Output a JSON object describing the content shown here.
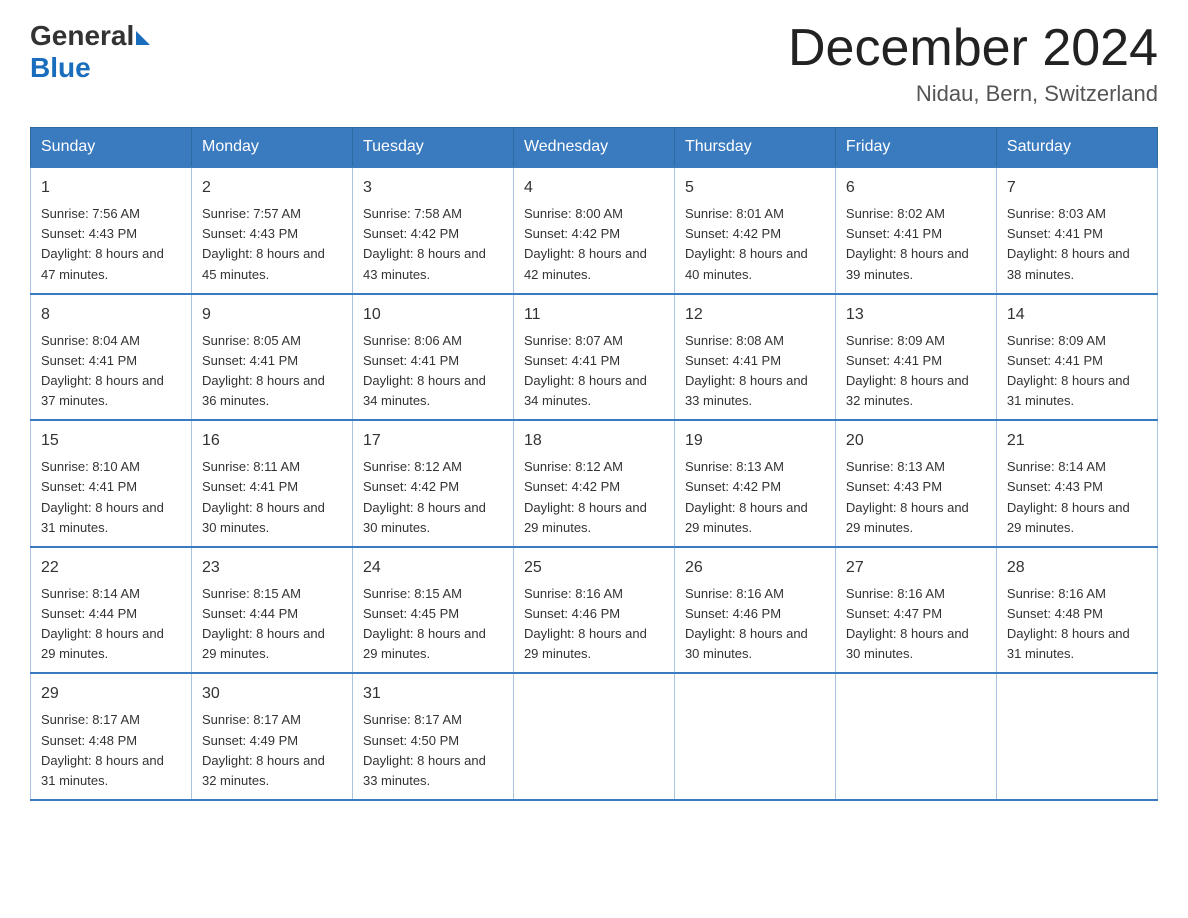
{
  "header": {
    "logo_general": "General",
    "logo_blue": "Blue",
    "month_title": "December 2024",
    "location": "Nidau, Bern, Switzerland"
  },
  "weekdays": [
    "Sunday",
    "Monday",
    "Tuesday",
    "Wednesday",
    "Thursday",
    "Friday",
    "Saturday"
  ],
  "weeks": [
    [
      {
        "day": "1",
        "sunrise": "7:56 AM",
        "sunset": "4:43 PM",
        "daylight": "8 hours and 47 minutes."
      },
      {
        "day": "2",
        "sunrise": "7:57 AM",
        "sunset": "4:43 PM",
        "daylight": "8 hours and 45 minutes."
      },
      {
        "day": "3",
        "sunrise": "7:58 AM",
        "sunset": "4:42 PM",
        "daylight": "8 hours and 43 minutes."
      },
      {
        "day": "4",
        "sunrise": "8:00 AM",
        "sunset": "4:42 PM",
        "daylight": "8 hours and 42 minutes."
      },
      {
        "day": "5",
        "sunrise": "8:01 AM",
        "sunset": "4:42 PM",
        "daylight": "8 hours and 40 minutes."
      },
      {
        "day": "6",
        "sunrise": "8:02 AM",
        "sunset": "4:41 PM",
        "daylight": "8 hours and 39 minutes."
      },
      {
        "day": "7",
        "sunrise": "8:03 AM",
        "sunset": "4:41 PM",
        "daylight": "8 hours and 38 minutes."
      }
    ],
    [
      {
        "day": "8",
        "sunrise": "8:04 AM",
        "sunset": "4:41 PM",
        "daylight": "8 hours and 37 minutes."
      },
      {
        "day": "9",
        "sunrise": "8:05 AM",
        "sunset": "4:41 PM",
        "daylight": "8 hours and 36 minutes."
      },
      {
        "day": "10",
        "sunrise": "8:06 AM",
        "sunset": "4:41 PM",
        "daylight": "8 hours and 34 minutes."
      },
      {
        "day": "11",
        "sunrise": "8:07 AM",
        "sunset": "4:41 PM",
        "daylight": "8 hours and 34 minutes."
      },
      {
        "day": "12",
        "sunrise": "8:08 AM",
        "sunset": "4:41 PM",
        "daylight": "8 hours and 33 minutes."
      },
      {
        "day": "13",
        "sunrise": "8:09 AM",
        "sunset": "4:41 PM",
        "daylight": "8 hours and 32 minutes."
      },
      {
        "day": "14",
        "sunrise": "8:09 AM",
        "sunset": "4:41 PM",
        "daylight": "8 hours and 31 minutes."
      }
    ],
    [
      {
        "day": "15",
        "sunrise": "8:10 AM",
        "sunset": "4:41 PM",
        "daylight": "8 hours and 31 minutes."
      },
      {
        "day": "16",
        "sunrise": "8:11 AM",
        "sunset": "4:41 PM",
        "daylight": "8 hours and 30 minutes."
      },
      {
        "day": "17",
        "sunrise": "8:12 AM",
        "sunset": "4:42 PM",
        "daylight": "8 hours and 30 minutes."
      },
      {
        "day": "18",
        "sunrise": "8:12 AM",
        "sunset": "4:42 PM",
        "daylight": "8 hours and 29 minutes."
      },
      {
        "day": "19",
        "sunrise": "8:13 AM",
        "sunset": "4:42 PM",
        "daylight": "8 hours and 29 minutes."
      },
      {
        "day": "20",
        "sunrise": "8:13 AM",
        "sunset": "4:43 PM",
        "daylight": "8 hours and 29 minutes."
      },
      {
        "day": "21",
        "sunrise": "8:14 AM",
        "sunset": "4:43 PM",
        "daylight": "8 hours and 29 minutes."
      }
    ],
    [
      {
        "day": "22",
        "sunrise": "8:14 AM",
        "sunset": "4:44 PM",
        "daylight": "8 hours and 29 minutes."
      },
      {
        "day": "23",
        "sunrise": "8:15 AM",
        "sunset": "4:44 PM",
        "daylight": "8 hours and 29 minutes."
      },
      {
        "day": "24",
        "sunrise": "8:15 AM",
        "sunset": "4:45 PM",
        "daylight": "8 hours and 29 minutes."
      },
      {
        "day": "25",
        "sunrise": "8:16 AM",
        "sunset": "4:46 PM",
        "daylight": "8 hours and 29 minutes."
      },
      {
        "day": "26",
        "sunrise": "8:16 AM",
        "sunset": "4:46 PM",
        "daylight": "8 hours and 30 minutes."
      },
      {
        "day": "27",
        "sunrise": "8:16 AM",
        "sunset": "4:47 PM",
        "daylight": "8 hours and 30 minutes."
      },
      {
        "day": "28",
        "sunrise": "8:16 AM",
        "sunset": "4:48 PM",
        "daylight": "8 hours and 31 minutes."
      }
    ],
    [
      {
        "day": "29",
        "sunrise": "8:17 AM",
        "sunset": "4:48 PM",
        "daylight": "8 hours and 31 minutes."
      },
      {
        "day": "30",
        "sunrise": "8:17 AM",
        "sunset": "4:49 PM",
        "daylight": "8 hours and 32 minutes."
      },
      {
        "day": "31",
        "sunrise": "8:17 AM",
        "sunset": "4:50 PM",
        "daylight": "8 hours and 33 minutes."
      },
      null,
      null,
      null,
      null
    ]
  ],
  "labels": {
    "sunrise_prefix": "Sunrise: ",
    "sunset_prefix": "Sunset: ",
    "daylight_prefix": "Daylight: "
  }
}
